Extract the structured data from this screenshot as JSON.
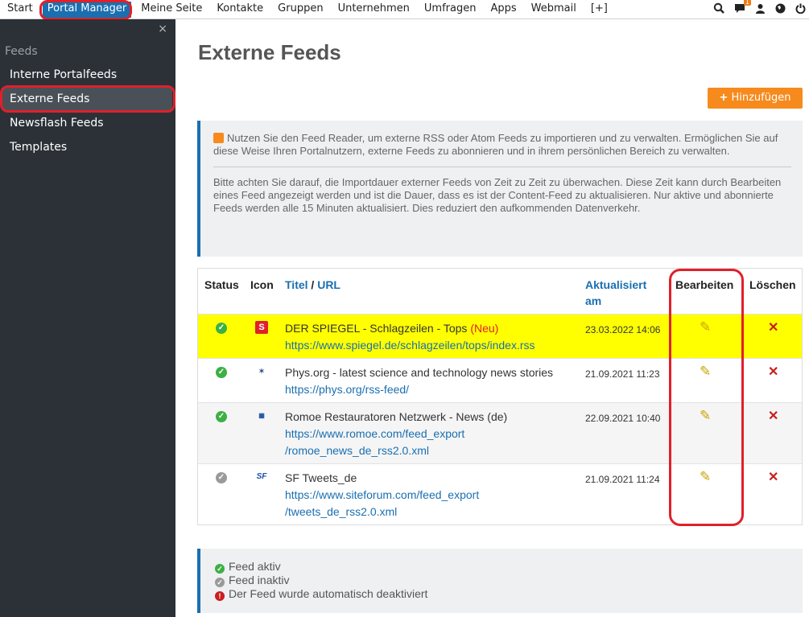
{
  "nav": {
    "items": [
      "Start",
      "Portal Manager",
      "Meine Seite",
      "Kontakte",
      "Gruppen",
      "Unternehmen",
      "Umfragen",
      "Apps",
      "Webmail",
      "[+]"
    ],
    "active": "Portal Manager",
    "notification_count": "1",
    "icons": [
      "search-zoom-icon",
      "chat-notification-icon",
      "user-icon",
      "globe-icon",
      "power-icon"
    ]
  },
  "sidebar": {
    "close": "×",
    "section": "Feeds",
    "items": [
      "Interne Portalfeeds",
      "Externe Feeds",
      "Newsflash Feeds",
      "Templates"
    ],
    "selected": "Externe Feeds"
  },
  "main": {
    "title": "Externe Feeds",
    "add_button": "Hinzufügen",
    "info_p1": "Nutzen Sie den Feed Reader, um externe RSS oder Atom Feeds zu importieren und zu verwalten. Ermöglichen Sie auf diese Weise Ihren Portalnutzern, externe Feeds zu abonnieren und in ihrem persönlichen Bereich zu verwalten.",
    "info_p2": "Bitte achten Sie darauf, die Importdauer externer Feeds von Zeit zu Zeit zu überwachen. Diese Zeit kann durch Bearbeiten eines Feed angezeigt werden und ist die Dauer, dass es ist der Content-Feed zu aktualisieren. Nur aktive und abonnierte Feeds werden alle 15 Minuten aktualisiert. Dies reduziert den aufkommenden Datenverkehr."
  },
  "table": {
    "headers": {
      "status": "Status",
      "icon": "Icon",
      "title": "Titel",
      "sep": "/",
      "url": "URL",
      "updated_1": "Aktualisiert",
      "updated_2": "am",
      "edit": "Bearbeiten",
      "delete": "Löschen"
    },
    "rows": [
      {
        "status": "active",
        "icon": "spiegel-icon",
        "title": "DER SPIEGEL - Schlagzeilen - Tops",
        "tag": "(Neu)",
        "url_1": "https://www.spiegel.de/schlagzeilen/tops/index.rss",
        "url_2": "",
        "date": "23.03.2022 14:06"
      },
      {
        "status": "active",
        "icon": "physorg-icon",
        "title": "Phys.org - latest science and technology news stories",
        "tag": "",
        "url_1": "https://phys.org/rss-feed/",
        "url_2": "",
        "date": "21.09.2021 11:23"
      },
      {
        "status": "active",
        "icon": "romoe-icon",
        "title": "Romoe Restauratoren Netzwerk - News (de)",
        "tag": "",
        "url_1": "https://www.romoe.com/feed_export",
        "url_2": "/romoe_news_de_rss2.0.xml",
        "date": "22.09.2021 10:40"
      },
      {
        "status": "inactive",
        "icon": "sf-icon",
        "title": "SF Tweets_de",
        "tag": "",
        "url_1": "https://www.siteforum.com/feed_export",
        "url_2": "/tweets_de_rss2.0.xml",
        "date": "21.09.2021 11:24"
      }
    ]
  },
  "legend": {
    "active": "Feed aktiv",
    "inactive": "Feed inaktiv",
    "error": "Der Feed wurde automatisch deaktiviert"
  },
  "colors": {
    "accent": "#1a6fb0",
    "add_button": "#f78a1d",
    "highlight_row": "#ffff00",
    "annotation": "#e0202a",
    "sidebar_bg": "#2b3137"
  }
}
